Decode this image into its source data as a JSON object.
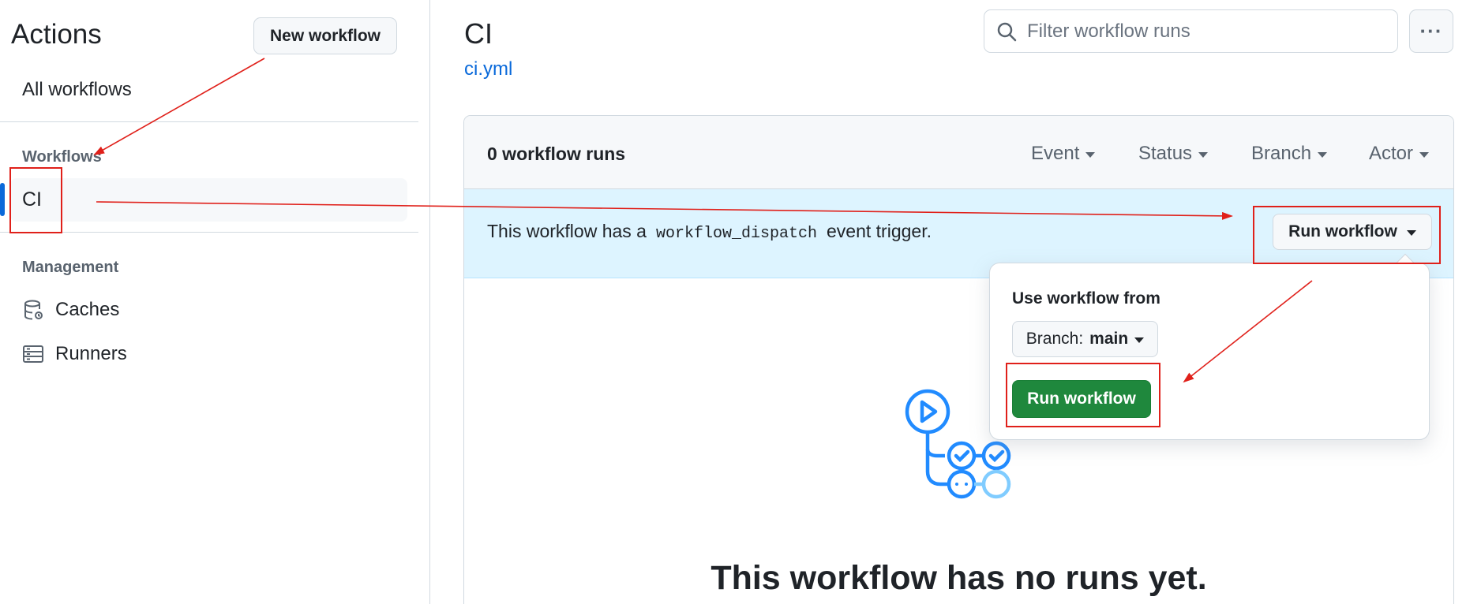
{
  "sidebar": {
    "title": "Actions",
    "new_workflow_label": "New workflow",
    "all_workflows": "All workflows",
    "workflows_heading": "Workflows",
    "selected_workflow": "CI",
    "management_heading": "Management",
    "items": [
      {
        "label": "Caches",
        "icon": "database-icon"
      },
      {
        "label": "Runners",
        "icon": "server-icon"
      }
    ]
  },
  "header": {
    "title": "CI",
    "file_link": "ci.yml",
    "filter_placeholder": "Filter workflow runs",
    "more_label": "···"
  },
  "runs": {
    "count_label": "0 workflow runs",
    "filters": [
      "Event",
      "Status",
      "Branch",
      "Actor"
    ]
  },
  "dispatch": {
    "text_before": "This workflow has a",
    "code": "workflow_dispatch",
    "text_after": "event trigger.",
    "run_button_label": "Run workflow"
  },
  "popover": {
    "label": "Use workflow from",
    "branch_prefix": "Branch:",
    "branch_value": "main",
    "run_button_label": "Run workflow"
  },
  "empty_state": {
    "title": "This workflow has no runs yet."
  },
  "colors": {
    "accent": "#0969da",
    "run_green": "#1f883d",
    "dispatch_bg": "#ddf4ff",
    "annotation_red": "#e0201a"
  }
}
